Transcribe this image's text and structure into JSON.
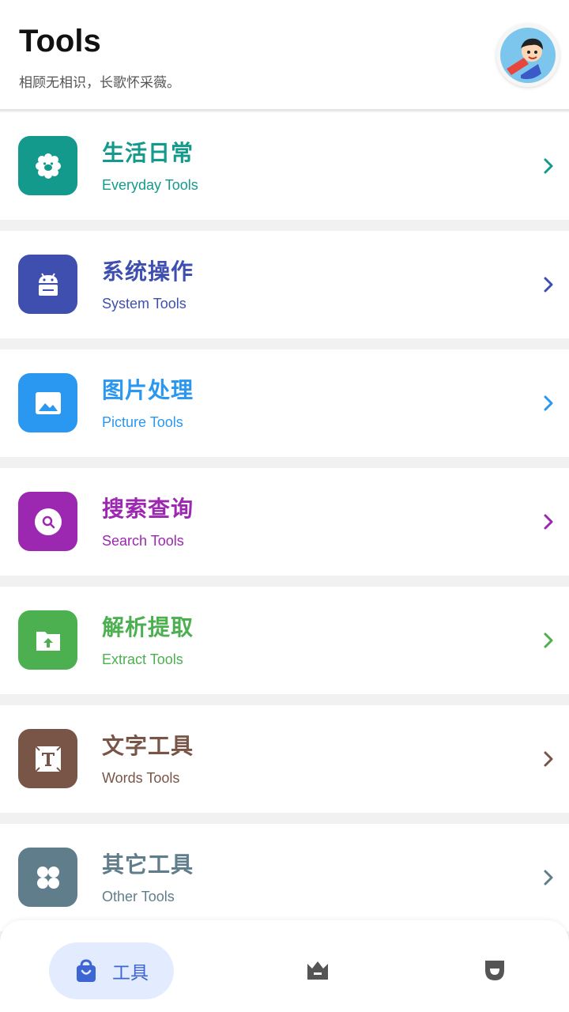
{
  "header": {
    "title": "Tools",
    "subtitle": "相顾无相识，长歌怀采薇。"
  },
  "categories": [
    {
      "cn": "生活日常",
      "en": "Everyday Tools",
      "color": "#149A8C",
      "icon": "flower-face-icon"
    },
    {
      "cn": "系统操作",
      "en": "System Tools",
      "color": "#3F4FB0",
      "icon": "android-icon"
    },
    {
      "cn": "图片处理",
      "en": "Picture Tools",
      "color": "#2A97F0",
      "icon": "image-icon"
    },
    {
      "cn": "搜索查询",
      "en": "Search Tools",
      "color": "#9C27B0",
      "icon": "search-icon"
    },
    {
      "cn": "解析提取",
      "en": "Extract Tools",
      "color": "#4CAF50",
      "icon": "upload-folder-icon"
    },
    {
      "cn": "文字工具",
      "en": "Words Tools",
      "color": "#795548",
      "icon": "text-icon"
    },
    {
      "cn": "其它工具",
      "en": "Other Tools",
      "color": "#607D8B",
      "icon": "grid-icon"
    }
  ],
  "nav": {
    "tools_label": "工具",
    "active_color": "#3D66D4",
    "inactive_color": "#555555"
  }
}
